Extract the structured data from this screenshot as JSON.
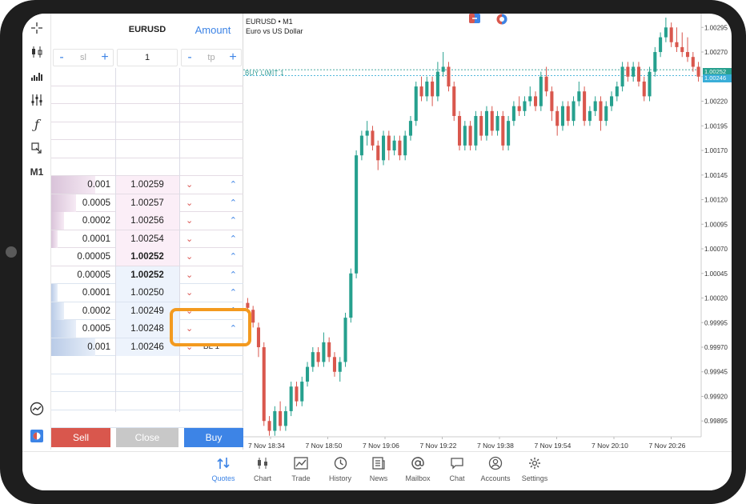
{
  "dom": {
    "symbol": "EURUSD",
    "amount_label": "Amount",
    "sl": {
      "minus": "-",
      "placeholder": "sl",
      "plus": "+"
    },
    "volume": "1",
    "tp": {
      "minus": "-",
      "placeholder": "tp",
      "plus": "+"
    },
    "asks": [
      {
        "volume": "0.001",
        "price": "1.00259",
        "depth": 0.35
      },
      {
        "volume": "0.0005",
        "price": "1.00257",
        "depth": 0.2
      },
      {
        "volume": "0.0002",
        "price": "1.00256",
        "depth": 0.1
      },
      {
        "volume": "0.0001",
        "price": "1.00254",
        "depth": 0.05
      },
      {
        "volume": "0.00005",
        "price": "1.00252",
        "depth": 0.0
      }
    ],
    "bids": [
      {
        "volume": "0.00005",
        "price": "1.00252",
        "depth": 0.0,
        "order": ""
      },
      {
        "volume": "0.0001",
        "price": "1.00250",
        "depth": 0.05,
        "order": ""
      },
      {
        "volume": "0.0002",
        "price": "1.00249",
        "depth": 0.1,
        "order": ""
      },
      {
        "volume": "0.0005",
        "price": "1.00248",
        "depth": 0.2,
        "order": ""
      },
      {
        "volume": "0.001",
        "price": "1.00246",
        "depth": 0.35,
        "order": "BL 1"
      }
    ],
    "sell_label": "Sell",
    "close_label": "Close",
    "buy_label": "Buy"
  },
  "chart_data": {
    "type": "candlestick",
    "symbol_line": "EURUSD • M1",
    "description": "Euro vs US Dollar",
    "order_line_label": "BUY LIMIT 1",
    "order_line_price": 1.00252,
    "bid_tag": "1.00252",
    "ask_tag": "1.00246",
    "y_ticks": [
      "1.00295",
      "1.00270",
      "1.00245",
      "1.00220",
      "1.00195",
      "1.00170",
      "1.00145",
      "1.00120",
      "1.00095",
      "1.00070",
      "1.00045",
      "1.00020",
      "0.99995",
      "0.99970",
      "0.99945",
      "0.99920",
      "0.99895"
    ],
    "x_ticks": [
      "7 Nov 18:34",
      "7 Nov 18:50",
      "7 Nov 19:06",
      "7 Nov 19:22",
      "7 Nov 19:38",
      "7 Nov 19:54",
      "7 Nov 20:10",
      "7 Nov 20:26"
    ],
    "ylim": [
      0.99883,
      1.00305
    ],
    "candles": [
      [
        1.00015,
        1.0001,
        1.0002,
        1.00005
      ],
      [
        1.00008,
        0.99995,
        1.00012,
        0.9999
      ],
      [
        0.9999,
        0.9997,
        0.99995,
        0.9996
      ],
      [
        0.9997,
        0.99895,
        0.99975,
        0.9989
      ],
      [
        0.99895,
        0.99885,
        0.999,
        0.9988
      ],
      [
        0.99885,
        0.99905,
        0.9991,
        0.9988
      ],
      [
        0.99905,
        0.9989,
        0.99915,
        0.99885
      ],
      [
        0.9989,
        0.99905,
        0.9991,
        0.99885
      ],
      [
        0.99905,
        0.9993,
        0.99935,
        0.999
      ],
      [
        0.9993,
        0.99915,
        0.99935,
        0.9991
      ],
      [
        0.99915,
        0.99935,
        0.9994,
        0.9991
      ],
      [
        0.99935,
        0.9995,
        0.99955,
        0.9993
      ],
      [
        0.9995,
        0.99965,
        0.9997,
        0.99945
      ],
      [
        0.99965,
        0.99955,
        0.9997,
        0.9995
      ],
      [
        0.99955,
        0.99975,
        0.99985,
        0.9995
      ],
      [
        0.99975,
        0.9996,
        0.9998,
        0.99955
      ],
      [
        0.9996,
        0.99945,
        0.99965,
        0.9994
      ],
      [
        0.99945,
        0.99955,
        0.9996,
        0.99935
      ],
      [
        0.99955,
        1.0,
        1.00005,
        0.9995
      ],
      [
        1.0,
        1.00045,
        1.0005,
        0.99995
      ],
      [
        1.00045,
        1.00165,
        1.0017,
        1.0004
      ],
      [
        1.00165,
        1.00185,
        1.0019,
        1.0016
      ],
      [
        1.00185,
        1.0019,
        1.002,
        1.00175
      ],
      [
        1.0019,
        1.00175,
        1.00195,
        1.0017
      ],
      [
        1.00175,
        1.0016,
        1.0018,
        1.0015
      ],
      [
        1.0016,
        1.00185,
        1.0019,
        1.00155
      ],
      [
        1.00185,
        1.0017,
        1.0019,
        1.0016
      ],
      [
        1.0017,
        1.0018,
        1.00185,
        1.00165
      ],
      [
        1.0018,
        1.00165,
        1.00185,
        1.0016
      ],
      [
        1.00165,
        1.00185,
        1.0019,
        1.0016
      ],
      [
        1.00185,
        1.002,
        1.00205,
        1.0018
      ],
      [
        1.002,
        1.00235,
        1.0024,
        1.00195
      ],
      [
        1.00235,
        1.00225,
        1.00245,
        1.0022
      ],
      [
        1.00225,
        1.0024,
        1.00245,
        1.0022
      ],
      [
        1.0024,
        1.00225,
        1.00245,
        1.00215
      ],
      [
        1.00225,
        1.0025,
        1.0026,
        1.0022
      ],
      [
        1.0025,
        1.00255,
        1.0027,
        1.00245
      ],
      [
        1.00255,
        1.00235,
        1.0026,
        1.0023
      ],
      [
        1.00235,
        1.00205,
        1.0024,
        1.002
      ],
      [
        1.00205,
        1.00175,
        1.0021,
        1.0017
      ],
      [
        1.00175,
        1.00195,
        1.002,
        1.0017
      ],
      [
        1.00195,
        1.00175,
        1.002,
        1.0017
      ],
      [
        1.00175,
        1.00205,
        1.0021,
        1.0017
      ],
      [
        1.00205,
        1.00185,
        1.0021,
        1.0018
      ],
      [
        1.00185,
        1.0021,
        1.00215,
        1.0018
      ],
      [
        1.0021,
        1.0019,
        1.00215,
        1.00185
      ],
      [
        1.0019,
        1.00205,
        1.0021,
        1.00185
      ],
      [
        1.00205,
        1.00175,
        1.0021,
        1.0017
      ],
      [
        1.00175,
        1.002,
        1.00205,
        1.0017
      ],
      [
        1.002,
        1.00215,
        1.0022,
        1.00195
      ],
      [
        1.00215,
        1.0021,
        1.00225,
        1.00205
      ],
      [
        1.0021,
        1.0022,
        1.00225,
        1.00205
      ],
      [
        1.0022,
        1.00225,
        1.00235,
        1.00215
      ],
      [
        1.00225,
        1.00215,
        1.0023,
        1.0021
      ],
      [
        1.00215,
        1.00245,
        1.0025,
        1.0021
      ],
      [
        1.00245,
        1.0023,
        1.00255,
        1.00225
      ],
      [
        1.0023,
        1.0021,
        1.00235,
        1.002
      ],
      [
        1.0021,
        1.00195,
        1.00215,
        1.00185
      ],
      [
        1.00195,
        1.00215,
        1.0022,
        1.0019
      ],
      [
        1.00215,
        1.002,
        1.0022,
        1.00195
      ],
      [
        1.002,
        1.0022,
        1.00225,
        1.00195
      ],
      [
        1.0022,
        1.0023,
        1.0024,
        1.00215
      ],
      [
        1.0023,
        1.002,
        1.00235,
        1.00195
      ],
      [
        1.002,
        1.0021,
        1.00215,
        1.00195
      ],
      [
        1.0021,
        1.0022,
        1.00225,
        1.00205
      ],
      [
        1.0022,
        1.002,
        1.00225,
        1.0019
      ],
      [
        1.002,
        1.00215,
        1.0022,
        1.00195
      ],
      [
        1.00215,
        1.00225,
        1.0023,
        1.0021
      ],
      [
        1.00225,
        1.00235,
        1.0024,
        1.0022
      ],
      [
        1.00235,
        1.00255,
        1.0026,
        1.0023
      ],
      [
        1.00255,
        1.00245,
        1.0026,
        1.0024
      ],
      [
        1.00245,
        1.00255,
        1.0026,
        1.0024
      ],
      [
        1.00255,
        1.0024,
        1.0026,
        1.00235
      ],
      [
        1.0024,
        1.00225,
        1.00245,
        1.0022
      ],
      [
        1.00225,
        1.0025,
        1.00255,
        1.0022
      ],
      [
        1.0025,
        1.0027,
        1.00275,
        1.00245
      ],
      [
        1.0027,
        1.00285,
        1.0029,
        1.00265
      ],
      [
        1.00285,
        1.00295,
        1.00305,
        1.0028
      ],
      [
        1.00295,
        1.0028,
        1.003,
        1.00275
      ],
      [
        1.0028,
        1.00275,
        1.00295,
        1.0027
      ],
      [
        1.00275,
        1.0027,
        1.0029,
        1.00265
      ],
      [
        1.0027,
        1.00265,
        1.00285,
        1.0026
      ],
      [
        1.00265,
        1.00255,
        1.0027,
        1.0025
      ],
      [
        1.00255,
        1.00245,
        1.0026,
        1.0024
      ]
    ]
  },
  "nav": [
    {
      "label": "Quotes",
      "icon": "quotes-icon"
    },
    {
      "label": "Chart",
      "icon": "chart-icon"
    },
    {
      "label": "Trade",
      "icon": "trade-icon"
    },
    {
      "label": "History",
      "icon": "history-icon"
    },
    {
      "label": "News",
      "icon": "news-icon"
    },
    {
      "label": "Mailbox",
      "icon": "mailbox-icon"
    },
    {
      "label": "Chat",
      "icon": "chat-icon"
    },
    {
      "label": "Accounts",
      "icon": "accounts-icon"
    },
    {
      "label": "Settings",
      "icon": "settings-icon"
    }
  ],
  "toolbar": {
    "timeframe": "M1",
    "function_glyph": "ƒ"
  },
  "colors": {
    "bull": "#26a08e",
    "bear": "#d9574d",
    "accent": "#3d84e6",
    "highlight": "#f39a1f"
  }
}
